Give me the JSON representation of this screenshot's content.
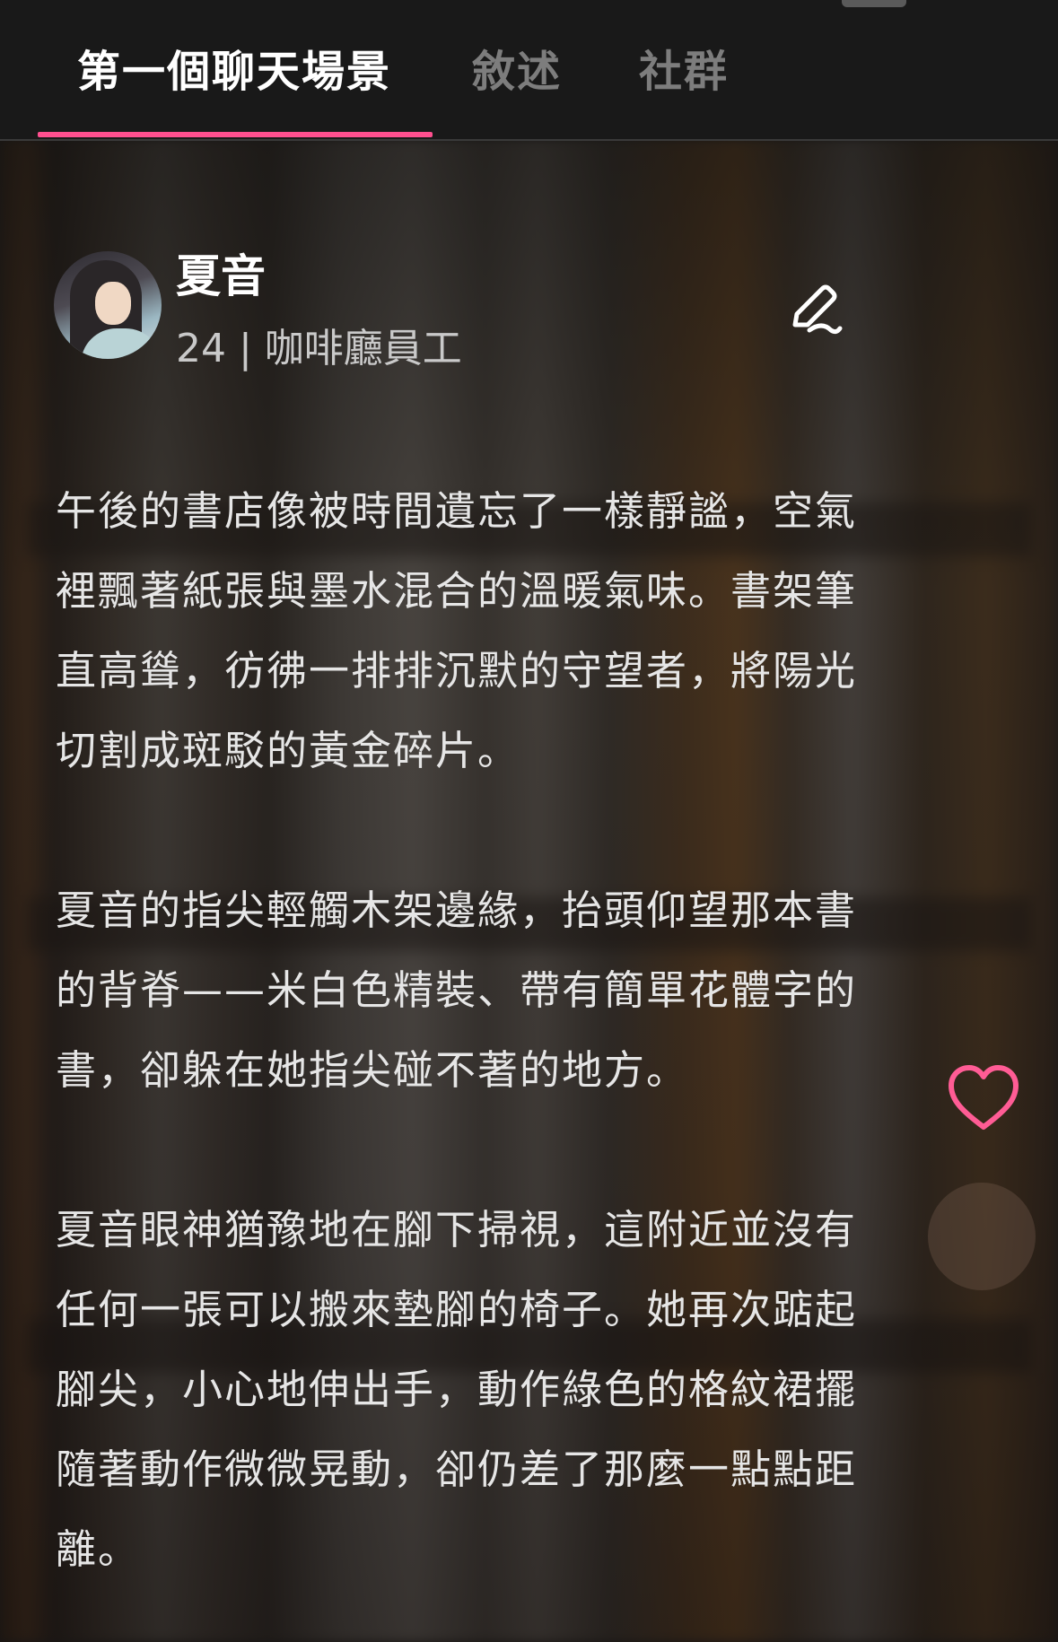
{
  "tabs": [
    {
      "label": "第一個聊天場景",
      "active": true
    },
    {
      "label": "敘述",
      "active": false
    },
    {
      "label": "社群",
      "active": false
    }
  ],
  "accent_color": "#ff4f8f",
  "character": {
    "name": "夏音",
    "meta": "24 | 咖啡廳員工",
    "avatar_icon": "avatar-portrait"
  },
  "story": {
    "paragraphs": [
      "午後的書店像被時間遺忘了一樣靜謐，空氣裡飄著紙張與墨水混合的溫暖氣味。書架筆直高聳，彷彿一排排沉默的守望者，將陽光切割成斑駁的黃金碎片。",
      "夏音的指尖輕觸木架邊緣，抬頭仰望那本書的背脊——米白色精裝、帶有簡單花體字的書，卻躲在她指尖碰不著的地方。",
      "夏音眼神猶豫地在腳下掃視，這附近並沒有任何一張可以搬來墊腳的椅子。她再次踮起腳尖，小心地伸出手，動作綠色的格紋裙擺隨著動作微微晃動，卻仍差了那麼一點點距離。"
    ]
  },
  "icons": {
    "edit": "pen-icon",
    "like": "heart-icon"
  }
}
